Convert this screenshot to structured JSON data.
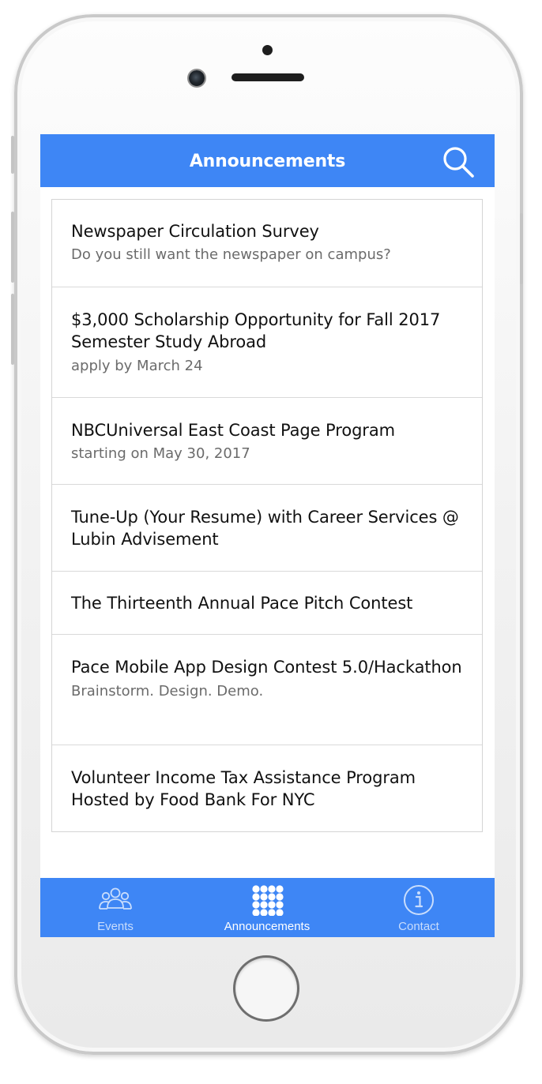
{
  "header": {
    "title": "Announcements",
    "search_icon": "search-icon"
  },
  "announcements": [
    {
      "title": "Newspaper Circulation Survey",
      "subtitle": "Do you still want the newspaper on campus?"
    },
    {
      "title": "$3,000 Scholarship Opportunity for Fall 2017 Semester Study Abroad",
      "subtitle": "apply by March 24"
    },
    {
      "title": "NBCUniversal East Coast Page Program",
      "subtitle": "starting on May 30, 2017"
    },
    {
      "title": "Tune-Up (Your Resume) with Career Services @ Lubin Advisement",
      "subtitle": ""
    },
    {
      "title": "The Thirteenth Annual Pace Pitch Contest",
      "subtitle": ""
    },
    {
      "title": "Pace Mobile App Design Contest 5.0/Hackathon",
      "subtitle": "Brainstorm. Design. Demo."
    },
    {
      "title": "Volunteer Income Tax Assistance Program Hosted by Food Bank For NYC",
      "subtitle": ""
    }
  ],
  "tabbar": {
    "tabs": [
      {
        "label": "Events",
        "icon": "people-icon",
        "active": false
      },
      {
        "label": "Announcements",
        "icon": "grid-icon",
        "active": true
      },
      {
        "label": "Contact",
        "icon": "info-icon",
        "active": false
      }
    ]
  },
  "colors": {
    "accent": "#3e86f5",
    "tab_inactive": "#c9ddfc",
    "title_text": "#111111",
    "subtitle_text": "#6b6b6b"
  }
}
